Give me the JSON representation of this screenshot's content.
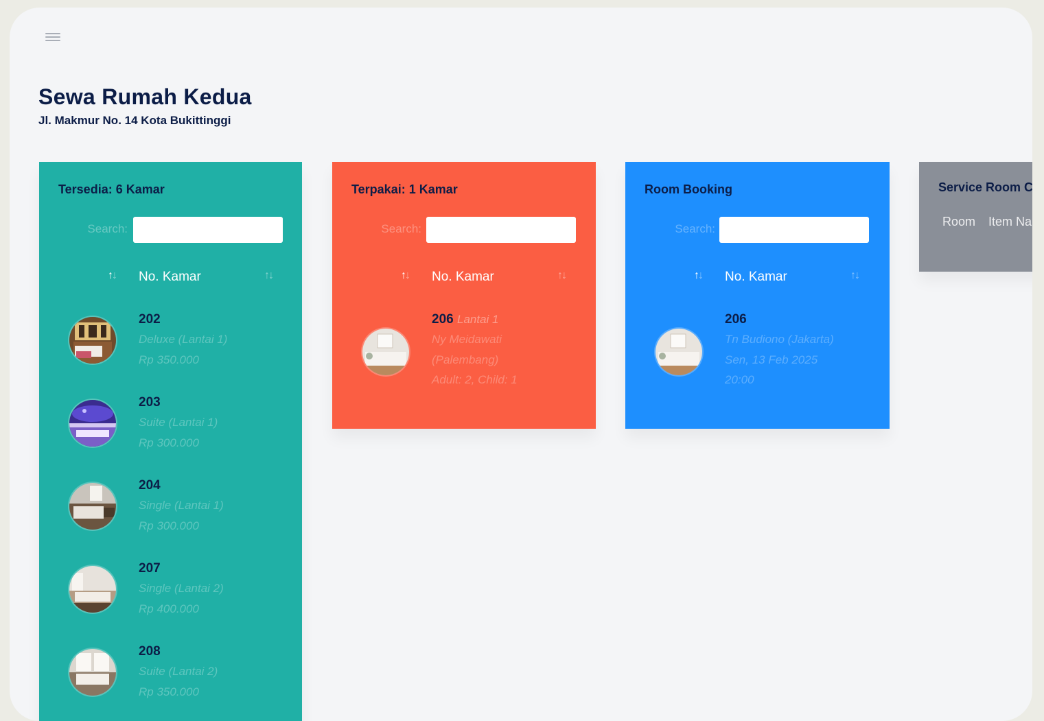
{
  "header": {
    "title": "Sewa Rumah Kedua",
    "address": "Jl. Makmur No. 14 Kota Bukittinggi"
  },
  "colors": {
    "available": "#20b0a6",
    "occupied": "#fb5e43",
    "booking": "#1e8ffe",
    "service": "#8a8f98",
    "title_text": "#0c1d47"
  },
  "icons": {
    "menu": "hamburger-icon",
    "sort": "sort-arrows-icon"
  },
  "search": {
    "label": "Search:",
    "value": ""
  },
  "panels": {
    "available": {
      "heading": "Tersedia: 6 Kamar",
      "column": "No. Kamar",
      "rooms": [
        {
          "no": "202",
          "type": "Deluxe (Lantai 1)",
          "price": "Rp 350.000"
        },
        {
          "no": "203",
          "type": "Suite (Lantai 1)",
          "price": "Rp 300.000"
        },
        {
          "no": "204",
          "type": "Single (Lantai 1)",
          "price": "Rp 300.000"
        },
        {
          "no": "207",
          "type": "Single (Lantai 2)",
          "price": "Rp 400.000"
        },
        {
          "no": "208",
          "type": "Suite (Lantai 2)",
          "price": "Rp 350.000"
        }
      ]
    },
    "occupied": {
      "heading": "Terpakai: 1 Kamar",
      "column": "No. Kamar",
      "rooms": [
        {
          "no": "206",
          "floor": "Lantai 1",
          "guest": "Ny Meidawati",
          "origin": "(Palembang)",
          "pax": "Adult: 2, Child: 1"
        }
      ]
    },
    "booking": {
      "heading": "Room Booking",
      "column": "No. Kamar",
      "rooms": [
        {
          "no": "206",
          "guest": "Tn Budiono (Jakarta)",
          "date": "Sen, 13 Feb 2025",
          "time": "20:00"
        }
      ]
    },
    "service": {
      "heading": "Service Room C",
      "columns": [
        "Room",
        "Item Na"
      ]
    }
  }
}
